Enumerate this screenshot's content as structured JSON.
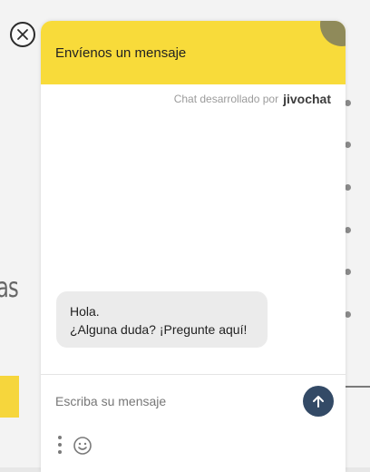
{
  "background": {
    "fragment_text": "as"
  },
  "close_button": {
    "icon": "close-icon"
  },
  "chat": {
    "title": "Envíenos un mensaje",
    "powered_by_label": "Chat desarrollado por",
    "powered_by_brand": "jivochat",
    "greeting_line1": "Hola.",
    "greeting_line2": "¿Alguna duda? ¡Pregunte aquí!",
    "input_placeholder": "Escriba su mensaje",
    "send_icon": "arrow-up-icon",
    "more_icon": "more-vertical-icon",
    "emoji_icon": "smiley-icon"
  },
  "colors": {
    "header_bg": "#f8db3a",
    "send_button_bg": "#334a66"
  }
}
